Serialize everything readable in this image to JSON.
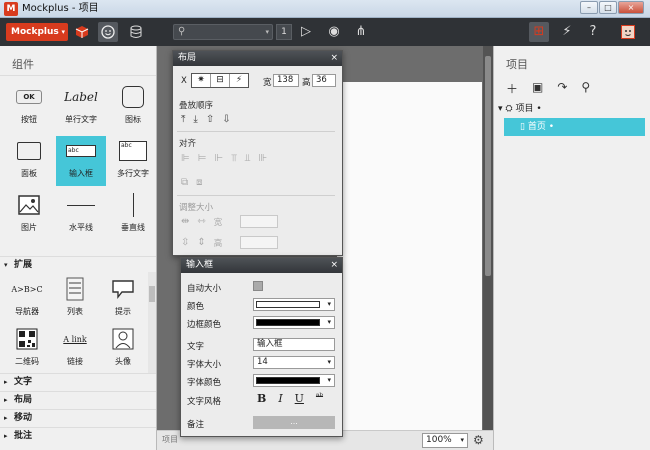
{
  "window": {
    "app_icon": "M",
    "title": "Mockplus - 项目",
    "controls": [
      "–",
      "□",
      "×"
    ]
  },
  "toolbar": {
    "brand": "Mockplus",
    "brand_caret": "▾",
    "icons": [
      "cube-icon",
      "smiley-icon",
      "database-icon",
      "play-icon",
      "eye-icon",
      "share-icon",
      "grid-icon",
      "bolt-icon",
      "help-icon",
      "avatar-icon"
    ],
    "play_glyph": "▷",
    "eye_glyph": "◉",
    "share_glyph": "⋔",
    "grid_glyph": "⊞",
    "bolt_glyph": "⚡",
    "help_glyph": "?",
    "search_glyph": "⚲",
    "search_caret": "▾",
    "page_number": "1",
    "accent": "#d83b1e"
  },
  "left_panel": {
    "title": "组件",
    "components": [
      {
        "label": "按钮",
        "glyph": "OK"
      },
      {
        "label": "单行文字",
        "glyph": "Label"
      },
      {
        "label": "图标",
        "glyph": ""
      },
      {
        "label": "面板",
        "glyph": ""
      },
      {
        "label": "输入框",
        "glyph": "abc",
        "selected": true
      },
      {
        "label": "多行文字",
        "glyph": "abc"
      },
      {
        "label": "图片",
        "glyph": ""
      },
      {
        "label": "水平线",
        "glyph": ""
      },
      {
        "label": "垂直线",
        "glyph": ""
      }
    ],
    "ext_header": "扩展",
    "ext_components": [
      {
        "label": "导航器",
        "glyph": "A>B>C"
      },
      {
        "label": "列表",
        "glyph": ""
      },
      {
        "label": "提示",
        "glyph": ""
      },
      {
        "label": "二维码",
        "glyph": ""
      },
      {
        "label": "链接",
        "glyph": "A link"
      },
      {
        "label": "头像",
        "glyph": ""
      }
    ],
    "sections": [
      "文字",
      "布局",
      "移动",
      "批注"
    ],
    "arrows": {
      "open": "▾",
      "closed": "▸"
    }
  },
  "layout_panel": {
    "title": "布局",
    "close": "×",
    "x_label": "X",
    "seg_icons": [
      "✷",
      "⊟",
      "⚡"
    ],
    "width_label": "宽",
    "width_value": "138",
    "height_label": "高",
    "height_value": "36",
    "stack_order": "叠放顺序",
    "stack_icons": [
      "⤒",
      "⤓",
      "⇧",
      "⇩"
    ],
    "align": "对齐",
    "align_icons": [
      "⊫",
      "⊨",
      "⊩",
      "⫪",
      "⫫",
      "⊪"
    ],
    "distribute_icons": [
      "⧉",
      "⧈"
    ],
    "resize": "调整大小",
    "resize_row1": [
      "⇹",
      "⇿"
    ],
    "resize_row2": [
      "⇳",
      "⇕"
    ],
    "resize_w": "宽",
    "resize_h": "高"
  },
  "input_panel": {
    "title": "输入框",
    "close": "×",
    "props": {
      "auto_size": "自动大小",
      "color": "颜色",
      "color_value": "#ffffff",
      "border_color": "边框颜色",
      "border_color_value": "#000000",
      "text": "文字",
      "text_value": "输入框",
      "font_size": "字体大小",
      "font_size_value": "14",
      "font_color": "字体颜色",
      "font_color_value": "#000000",
      "font_style": "文字风格",
      "styles": [
        "B",
        "I",
        "U",
        "ᵃᵇ"
      ],
      "note": "备注",
      "note_btn": "...",
      "caret": "▾"
    }
  },
  "canvas": {
    "status_label": "项目",
    "zoom": "100%",
    "zoom_caret": "▾",
    "gear": "⚙"
  },
  "right_panel": {
    "title": "项目",
    "tools": [
      "＋",
      "▣",
      "↷",
      "⚲"
    ],
    "tree": [
      {
        "glyph": "▾ ⛭",
        "label": "项目 •"
      },
      {
        "glyph": "▯",
        "label": "首页 •",
        "selected": true
      }
    ]
  }
}
